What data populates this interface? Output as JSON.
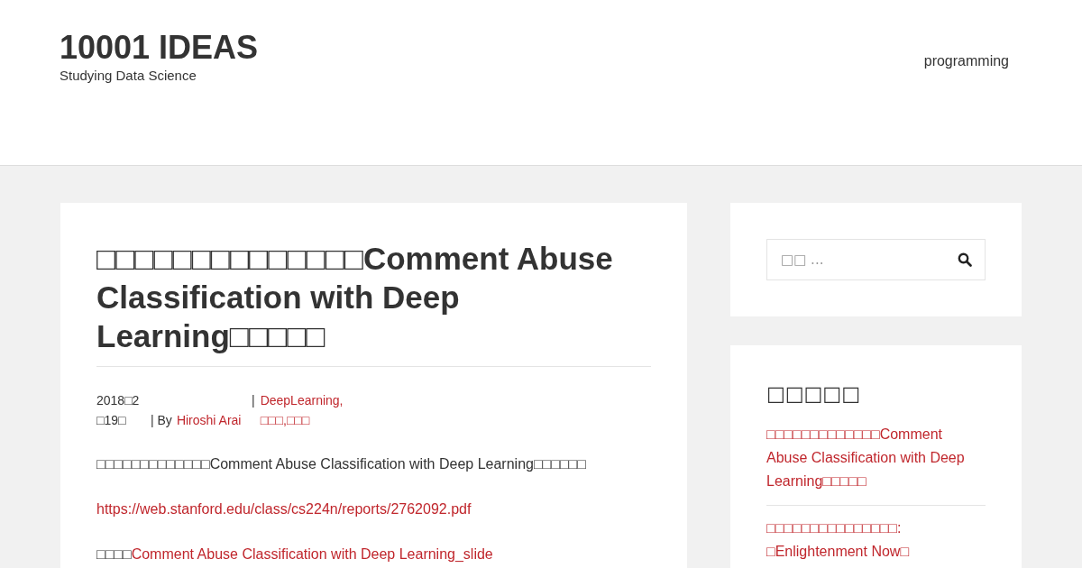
{
  "site": {
    "title": "10001 IDEAS",
    "tagline": "Studying Data Science"
  },
  "nav": [
    {
      "label": "programming"
    }
  ],
  "post": {
    "title": "□□□□□□□□□□□□□□Comment Abuse Classification with Deep Learning□□□□□",
    "date": "2018□2□19□",
    "by": "| By",
    "author": "Hiroshi Arai",
    "separator": "|",
    "categories": [
      {
        "label": "DeepLearning,"
      },
      {
        "label": "□□□,□□□"
      }
    ],
    "paragraphs": [
      {
        "text": "□□□□□□□□□□□□□Comment Abuse Classification with Deep Learning□□□□□□"
      },
      {
        "link": "https://web.stanford.edu/class/cs224n/reports/2762092.pdf"
      },
      {
        "text": "□□□□",
        "link": "Comment Abuse Classification with Deep Learning_slide"
      }
    ]
  },
  "search": {
    "placeholder": "□□ ..."
  },
  "widget": {
    "title": "□□□□□",
    "links": [
      {
        "label": "□□□□□□□□□□□□□Comment Abuse Classification with Deep Learning□□□□□"
      },
      {
        "label": "□□□□□□□□□□□□□□□: □Enlightenment Now□"
      }
    ]
  }
}
